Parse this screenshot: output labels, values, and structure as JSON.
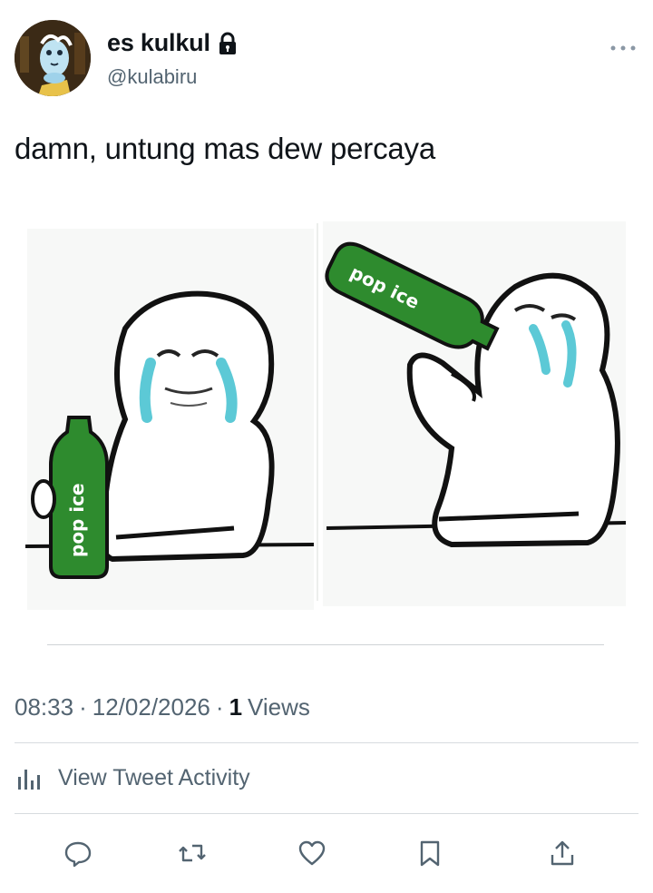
{
  "author": {
    "display_name": "es kulkul",
    "handle": "@kulabiru",
    "protected_icon": "lock-icon",
    "avatar": "cartoon-avatar"
  },
  "tweet": {
    "text": "damn, untung mas dew percaya"
  },
  "media": {
    "panel_left_label": "pop ice",
    "panel_right_label": "pop ice",
    "bottle_color": "#2e8b2e"
  },
  "meta": {
    "time": "08:33",
    "date": "12/02/2026",
    "views_count": "1",
    "views_label": "Views",
    "separator": "·"
  },
  "activity": {
    "label": "View Tweet Activity",
    "icon": "bar-chart-icon"
  },
  "actions": [
    {
      "name": "reply",
      "icon": "reply-icon"
    },
    {
      "name": "retweet",
      "icon": "retweet-icon"
    },
    {
      "name": "like",
      "icon": "heart-icon"
    },
    {
      "name": "bookmark",
      "icon": "bookmark-icon"
    },
    {
      "name": "share",
      "icon": "share-icon"
    }
  ],
  "colors": {
    "text_primary": "#0f1419",
    "text_secondary": "#536471",
    "divider": "#d7dbdf"
  }
}
